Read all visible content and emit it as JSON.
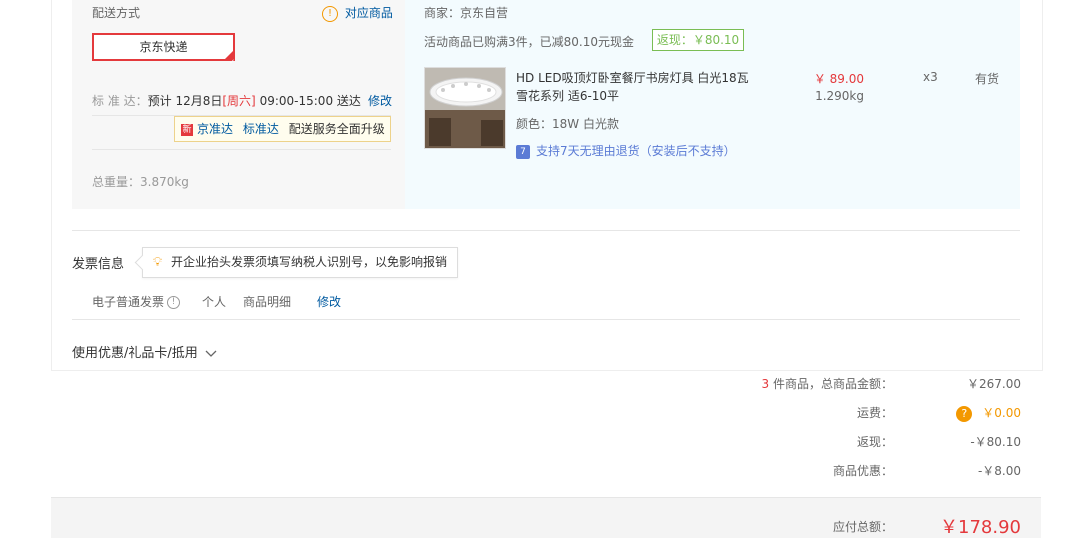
{
  "shipping": {
    "title": "配送方式",
    "match_link": "对应商品",
    "method": "京东快递",
    "standard_label": "标 准 达：",
    "estimate_prefix": "预计 12月8日",
    "weekday": "[周六]",
    "time_range": "09:00-15:00 送达",
    "modify": "修改",
    "tip_tag": "新",
    "tip_brand": "京准达",
    "tip_standard": "标准达",
    "tip_text": "配送服务全面升级",
    "total_weight": "总重量：3.870kg"
  },
  "merchant": {
    "label": "商家：京东自营",
    "promo": "活动商品已购满3件，已减80.10元现金",
    "rebate": "返现：￥80.10"
  },
  "product": {
    "name_line1": "HD LED吸顶灯卧室餐厅书房灯具 白光18瓦",
    "name_line2": "雪花系列 适6-10平",
    "spec": "颜色：18W 白光款",
    "return_icon": "7",
    "return_policy": "支持7天无理由退货（安装后不支持）",
    "price": "￥ 89.00",
    "weight": "1.290kg",
    "qty": "x3",
    "stock": "有货"
  },
  "invoice": {
    "title": "发票信息",
    "tip": "开企业抬头发票须填写纳税人识别号，以免影响报销",
    "type": "电子普通发票",
    "holder": "个人",
    "content": "商品明细",
    "modify": "修改"
  },
  "coupon": {
    "label": "使用优惠/礼品卡/抵用"
  },
  "summary": {
    "count": "3",
    "count_suffix": " 件商品，总商品金额：",
    "goods_total": "￥267.00",
    "freight_label": "运费：",
    "freight_value": "￥0.00",
    "cashback_label": "返现：",
    "cashback_value": "-￥80.10",
    "discount_label": "商品优惠：",
    "discount_value": "-￥8.00",
    "payable_label": "应付总额：",
    "payable_value": "￥178.90"
  },
  "colors": {
    "accent_red": "#e4393c",
    "link_blue": "#005aa0",
    "rebate_green": "#7abd54",
    "warn_orange": "#f39800"
  },
  "icons": [
    "warning-icon",
    "check-corner-icon",
    "bulb-icon",
    "info-icon",
    "question-icon",
    "chevron-down-icon",
    "return-badge-icon"
  ]
}
